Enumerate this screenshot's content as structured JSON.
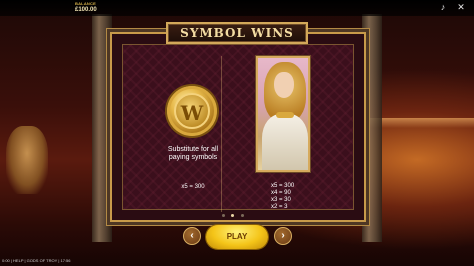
{
  "balance": {
    "label": "BALANCE",
    "value": "£100.00"
  },
  "topbar_icons": [
    "speaker-icon",
    "close-icon"
  ],
  "title": "SYMBOL WINS",
  "wild": {
    "symbol_letter": "W",
    "description": "Substitute for all paying symbols",
    "payout": "x5 = 300"
  },
  "premium": {
    "payouts": [
      "x5 = 300",
      "x4 = 90",
      "x3 = 30",
      "x2 = 3"
    ]
  },
  "pagination": {
    "total": 5,
    "active_index": 1
  },
  "buttons": {
    "prev": "‹",
    "next": "›",
    "play": "PLAY"
  },
  "footer": "0:00 | HELP | GODS OF TROY | 17:56",
  "colors": {
    "accent_gold": "#d3a95a",
    "play_yellow": "#f4c418",
    "panel": "#3b0f1c"
  }
}
